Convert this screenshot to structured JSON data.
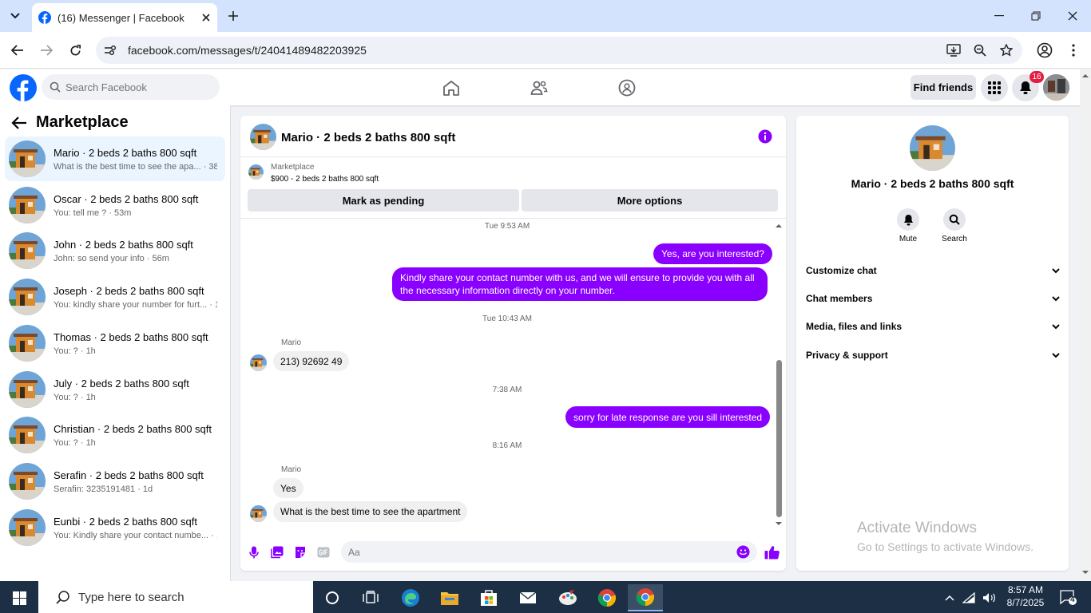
{
  "browser": {
    "tab_title": "(16) Messenger | Facebook",
    "url": "facebook.com/messages/t/24041489482203925"
  },
  "fb": {
    "search_placeholder": "Search Facebook",
    "find_friends": "Find friends",
    "notif_count": "16"
  },
  "marketplace": {
    "title": "Marketplace",
    "conversations": [
      {
        "name": "Mario · 2 beds 2 baths 800 sqft",
        "preview": "What is the best time to see the apa... · 38m",
        "active": true
      },
      {
        "name": "Oscar · 2 beds 2 baths 800 sqft",
        "preview": "You: tell me ? · 53m"
      },
      {
        "name": "John · 2 beds 2 baths 800 sqft",
        "preview": "John: so send your info · 56m"
      },
      {
        "name": "Joseph · 2 beds 2 baths 800 sqft",
        "preview": "You: kindly share your number for furt... · 1h"
      },
      {
        "name": "Thomas · 2 beds 2 baths 800 sqft",
        "preview": "You: ? · 1h"
      },
      {
        "name": "July · 2 beds 2 baths 800 sqft",
        "preview": "You: ? · 1h"
      },
      {
        "name": "Christian · 2 beds 2 baths 800 sqft",
        "preview": "You: ? · 1h"
      },
      {
        "name": "Serafin · 2 beds 2 baths 800 sqft",
        "preview": "Serafin: 3235191481 · 1d"
      },
      {
        "name": "Eunbi · 2 beds 2 baths 800 sqft",
        "preview": "You: Kindly share your contact numbe... · 1d"
      }
    ]
  },
  "chat": {
    "title": "Mario · 2 beds 2 baths 800 sqft",
    "listing_source": "Marketplace",
    "listing_info": "$900 - 2 beds 2 baths 800 sqft",
    "mark_pending": "Mark as pending",
    "more_options": "More options",
    "messages": {
      "ts1": "Tue 9:53 AM",
      "out1": "Yes, are you interested?",
      "out2": "Kindly share your contact number with us, and we will ensure to provide you with all the necessary information directly on your number.",
      "ts2": "Tue 10:43 AM",
      "sender1": "Mario",
      "in1": "213) 92692 49",
      "ts3": "7:38 AM",
      "out3": "sorry for late response are you sill interested",
      "ts4": "8:16 AM",
      "sender2": "Mario",
      "in2": "Yes",
      "in3": "What is the best time to see the apartment"
    },
    "composer_placeholder": "Aa"
  },
  "details": {
    "name": "Mario · 2 beds 2 baths 800 sqft",
    "mute": "Mute",
    "search": "Search",
    "sections": [
      "Customize chat",
      "Chat members",
      "Media, files and links",
      "Privacy & support"
    ]
  },
  "watermark": {
    "line1": "Activate Windows",
    "line2": "Go to Settings to activate Windows."
  },
  "taskbar": {
    "search_placeholder": "Type here to search",
    "time": "8:57 AM",
    "date": "8/7/2025",
    "notif_count": "4"
  },
  "colors": {
    "accent_purple": "#8a00ff",
    "fb_blue": "#0866ff",
    "badge_red": "#e41e3f",
    "taskbar": "#1c2f45"
  }
}
